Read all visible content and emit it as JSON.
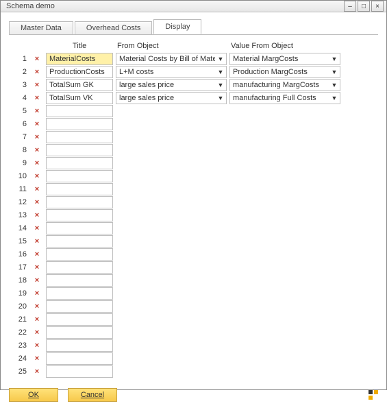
{
  "window": {
    "title": "Schema demo",
    "min_label": "–",
    "max_label": "□",
    "close_label": "×"
  },
  "tabs": [
    {
      "label": "Master Data",
      "active": false
    },
    {
      "label": "Overhead Costs",
      "active": false
    },
    {
      "label": "Display",
      "active": true
    }
  ],
  "headers": {
    "title": "Title",
    "from_object": "From Object",
    "value_from_object": "Value From Object"
  },
  "row_count": 25,
  "highlight_row": 1,
  "rows": [
    {
      "title": "MaterialCosts",
      "from_object": "Material Costs by Bill of Material",
      "value_from_object": "Material MargCosts"
    },
    {
      "title": "ProductionCosts",
      "from_object": "L+M costs",
      "value_from_object": "Production MargCosts"
    },
    {
      "title": "TotalSum GK",
      "from_object": "large sales price",
      "value_from_object": "manufacturing MargCosts"
    },
    {
      "title": "TotalSum VK",
      "from_object": "large sales price",
      "value_from_object": "manufacturing Full Costs"
    }
  ],
  "buttons": {
    "ok": "OK",
    "cancel": "Cancel"
  },
  "delete_glyph": "×"
}
